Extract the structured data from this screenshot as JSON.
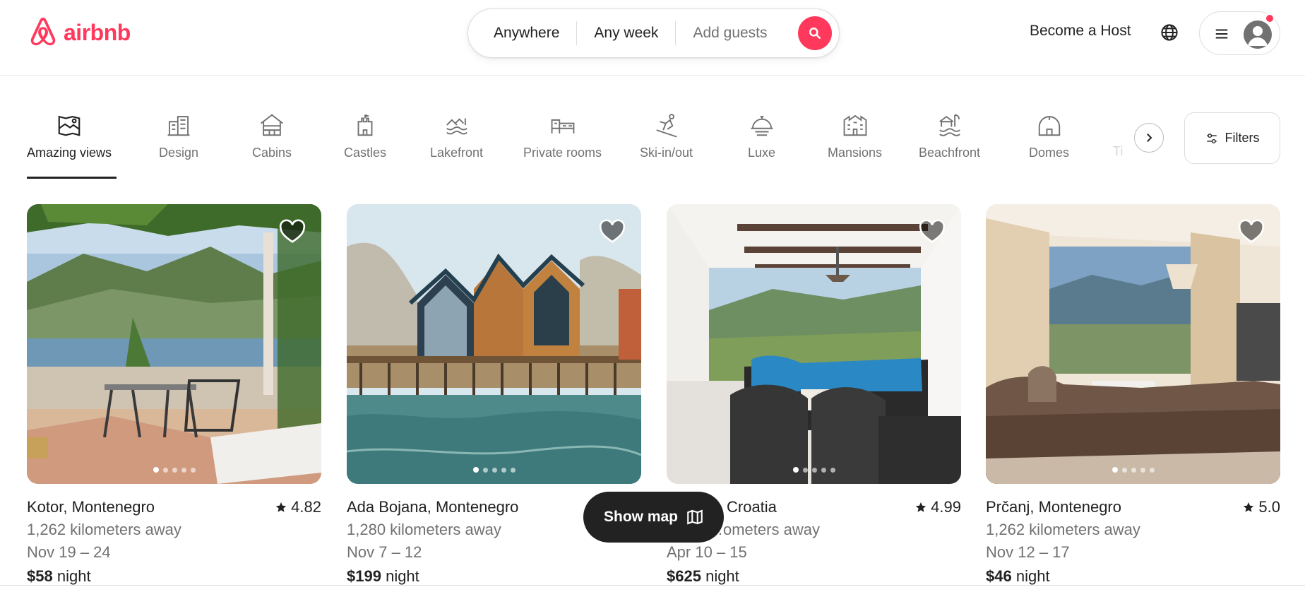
{
  "brand": {
    "name": "airbnb",
    "color": "#ff385c"
  },
  "search": {
    "location": "Anywhere",
    "dates": "Any week",
    "guests": "Add guests",
    "search_icon": "search-icon"
  },
  "header": {
    "host_label": "Become a Host",
    "globe_icon": "globe-icon",
    "menu_icon": "hamburger-icon",
    "avatar_icon": "avatar-icon",
    "has_notification": true
  },
  "categories": [
    {
      "label": "Amazing views",
      "icon": "amazing-views-icon",
      "active": true
    },
    {
      "label": "Design",
      "icon": "design-icon",
      "active": false
    },
    {
      "label": "Cabins",
      "icon": "cabins-icon",
      "active": false
    },
    {
      "label": "Castles",
      "icon": "castles-icon",
      "active": false
    },
    {
      "label": "Lakefront",
      "icon": "lakefront-icon",
      "active": false
    },
    {
      "label": "Private rooms",
      "icon": "private-rooms-icon",
      "active": false
    },
    {
      "label": "Ski-in/out",
      "icon": "ski-icon",
      "active": false
    },
    {
      "label": "Luxe",
      "icon": "luxe-icon",
      "active": false
    },
    {
      "label": "Mansions",
      "icon": "mansions-icon",
      "active": false
    },
    {
      "label": "Beachfront",
      "icon": "beachfront-icon",
      "active": false
    },
    {
      "label": "Domes",
      "icon": "domes-icon",
      "active": false
    },
    {
      "label": "Ti",
      "icon": "partial-category",
      "active": false
    }
  ],
  "filters": {
    "label": "Filters",
    "icon": "filters-icon"
  },
  "listings": [
    {
      "location": "Kotor, Montenegro",
      "rating": "4.82",
      "distance": "1,262 kilometers away",
      "dates": "Nov 19 – 24",
      "price": "$58",
      "price_unit": "night",
      "photo_count": 5,
      "active_photo": 0
    },
    {
      "location": "Ada Bojana, Montenegro",
      "rating": "",
      "distance": "1,280 kilometers away",
      "dates": "Nov 7 – 12",
      "price": "$199",
      "price_unit": "night",
      "photo_count": 5,
      "active_photo": 0
    },
    {
      "location": "Croatia",
      "rating": "4.99",
      "distance": "…ometers away",
      "dates": "Apr 10 – 15",
      "price": "$625",
      "price_unit": "night",
      "photo_count": 5,
      "active_photo": 0
    },
    {
      "location": "Prčanj, Montenegro",
      "rating": "5.0",
      "distance": "1,262 kilometers away",
      "dates": "Nov 12 – 17",
      "price": "$46",
      "price_unit": "night",
      "photo_count": 5,
      "active_photo": 0
    }
  ],
  "show_map": {
    "label": "Show map",
    "icon": "map-icon"
  }
}
